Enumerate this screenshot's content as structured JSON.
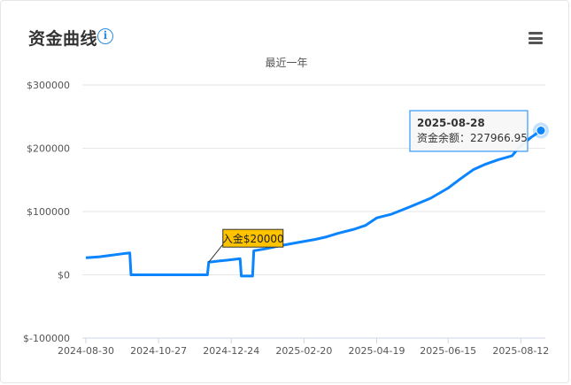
{
  "header": {
    "title": "资金曲线",
    "info_icon": "info-icon",
    "menu_icon": "hamburger-menu-icon"
  },
  "chart_data": {
    "type": "line",
    "subtitle": "最近一年",
    "ylim": [
      -100000,
      300000
    ],
    "y_ticks": [
      -100000,
      0,
      100000,
      200000,
      300000
    ],
    "y_tick_labels": [
      "$-100000",
      "$0",
      "$100000",
      "$200000",
      "$300000"
    ],
    "x_ticks": [
      "2024-08-30",
      "2024-10-27",
      "2024-12-24",
      "2025-02-20",
      "2025-04-19",
      "2025-06-15",
      "2025-08-12"
    ],
    "x_start": "2024-08-30",
    "x_end": "2025-08-28",
    "series": [
      {
        "color": "#0a84ff",
        "points": [
          [
            "2024-08-30",
            27000
          ],
          [
            "2024-09-10",
            28500
          ],
          [
            "2024-09-20",
            31000
          ],
          [
            "2024-10-01",
            34000
          ],
          [
            "2024-10-04",
            34500
          ],
          [
            "2024-10-05",
            0
          ],
          [
            "2024-11-10",
            0
          ],
          [
            "2024-12-01",
            0
          ],
          [
            "2024-12-05",
            0
          ],
          [
            "2024-12-06",
            20000
          ],
          [
            "2024-12-15",
            22000
          ],
          [
            "2024-12-25",
            24000
          ],
          [
            "2024-12-31",
            25500
          ],
          [
            "2025-01-01",
            -2000
          ],
          [
            "2025-01-10",
            -2000
          ],
          [
            "2025-01-11",
            38000
          ],
          [
            "2025-01-20",
            41000
          ],
          [
            "2025-02-01",
            46000
          ],
          [
            "2025-02-15",
            51000
          ],
          [
            "2025-03-01",
            56000
          ],
          [
            "2025-03-10",
            60000
          ],
          [
            "2025-03-20",
            66000
          ],
          [
            "2025-04-01",
            72000
          ],
          [
            "2025-04-10",
            78000
          ],
          [
            "2025-04-19",
            90000
          ],
          [
            "2025-05-01",
            96000
          ],
          [
            "2025-05-15",
            107000
          ],
          [
            "2025-06-01",
            121000
          ],
          [
            "2025-06-15",
            137000
          ],
          [
            "2025-06-25",
            152000
          ],
          [
            "2025-07-05",
            166000
          ],
          [
            "2025-07-15",
            175000
          ],
          [
            "2025-07-25",
            182000
          ],
          [
            "2025-08-05",
            188000
          ],
          [
            "2025-08-10",
            200000
          ],
          [
            "2025-08-20",
            217000
          ],
          [
            "2025-08-28",
            227966.95
          ]
        ]
      }
    ],
    "annotation": {
      "date": "2024-12-06",
      "value": 20000,
      "label": "入金$20000"
    },
    "tooltip": {
      "date": "2025-08-28",
      "label": "资金余额：",
      "value_text": "227966.95",
      "value": 227966.95
    },
    "legend": "none",
    "grid": "horizontal"
  }
}
